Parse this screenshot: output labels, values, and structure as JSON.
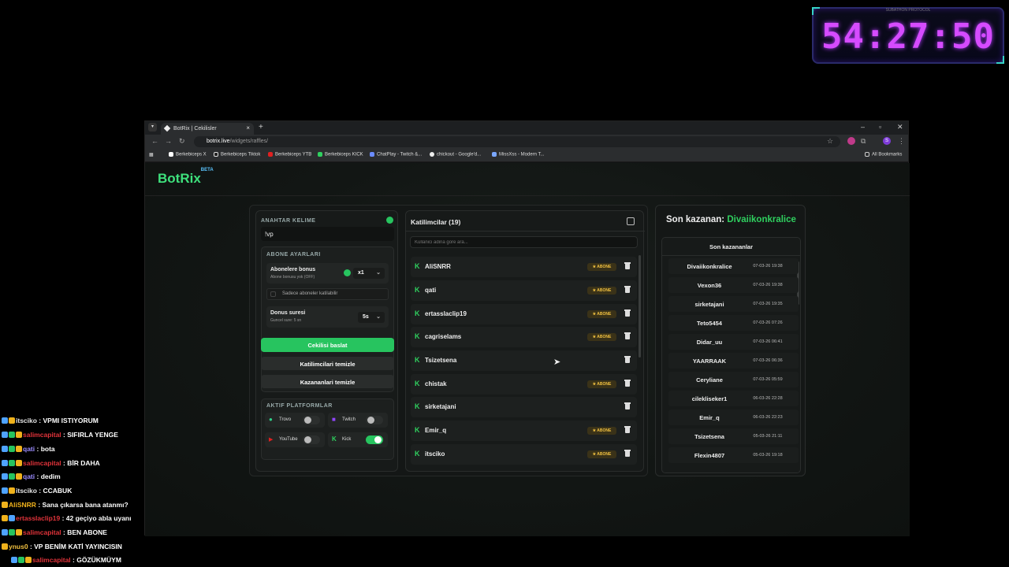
{
  "timer": {
    "caption": "SUBATHON PROTOCOL",
    "value": "54:27:50"
  },
  "browser": {
    "tab_title": "BotRix | Cekilisler",
    "url_host": "botrix.live",
    "url_path": "/widgets/raffles/",
    "bookmarks": [
      "Berkebiceps X",
      "Berkebiceps Tiktok",
      "Berkebiceps YTB",
      "Berkebiceps KICK",
      "ChatPlay - Twitch &...",
      "chickout - Google'd...",
      "MissXss - Modern T..."
    ],
    "all_bookmarks": "All Bookmarks",
    "profile_initial": "S"
  },
  "app": {
    "logo": "BotRix",
    "logo_badge": "BETA"
  },
  "settings": {
    "keyword_label": "ANAHTAR KELIME",
    "keyword_value": "!vp",
    "sub_settings_label": "ABONE AYARLARI",
    "sub_bonus_title": "Abonelere bonus",
    "sub_bonus_desc": "Abone bonusu yok (OFF)",
    "multiplier": "x1",
    "subs_only_label": "Sadece aboneler katilabilir",
    "duration_title": "Donus suresi",
    "duration_desc": "Guncel sure: 5 sn",
    "duration_value": "5s",
    "start_button": "Cekilisi baslat",
    "clear_participants_button": "Katilimcilari temizle",
    "clear_winners_button": "Kazananlari temizle",
    "platforms_label": "AKTIF PLATFORMLAR",
    "platforms": [
      {
        "name": "Trovo",
        "on": false
      },
      {
        "name": "Twitch",
        "on": false
      },
      {
        "name": "YouTube",
        "on": false
      },
      {
        "name": "Kick",
        "on": true
      }
    ]
  },
  "participants": {
    "title": "Katilimcilar (19)",
    "search_placeholder": "Kullanici adina gore ara...",
    "badge_label": "★ ABONE",
    "rows": [
      {
        "name": "AliSNRR",
        "sub": true
      },
      {
        "name": "qati",
        "sub": true
      },
      {
        "name": "ertasslaclip19",
        "sub": true
      },
      {
        "name": "cagriselams",
        "sub": true
      },
      {
        "name": "Tsizetsena",
        "sub": false
      },
      {
        "name": "chistak",
        "sub": true
      },
      {
        "name": "sirketajani",
        "sub": false
      },
      {
        "name": "Emir_q",
        "sub": true
      },
      {
        "name": "itsciko",
        "sub": true
      }
    ]
  },
  "winners": {
    "headline_prefix": "Son kazanan:",
    "headline_name": "Divaiikonkralice",
    "list_title": "Son kazananlar",
    "rows": [
      {
        "name": "Divaiikonkralice",
        "date": "07-03-26 19:38"
      },
      {
        "name": "Vexon36",
        "date": "07-03-26 19:38"
      },
      {
        "name": "sirketajani",
        "date": "07-03-26 19:35"
      },
      {
        "name": "Teto5454",
        "date": "07-03-26 07:26"
      },
      {
        "name": "Didar_uu",
        "date": "07-03-26 06:41"
      },
      {
        "name": "YAARRAAK",
        "date": "07-03-26 06:36"
      },
      {
        "name": "Ceryliane",
        "date": "07-03-26 05:59"
      },
      {
        "name": "cilekliseker1",
        "date": "06-03-26 22:28"
      },
      {
        "name": "Emir_q",
        "date": "06-03-26 22:23"
      },
      {
        "name": "Tsizetsena",
        "date": "05-03-26 21:11"
      },
      {
        "name": "Flexin4807",
        "date": "05-03-26 19:18"
      }
    ]
  },
  "chat": [
    {
      "user": "itsciko",
      "msg": "VPMI ISTIYORUM",
      "color": "#e6e6e6"
    },
    {
      "user": "salimcapital",
      "msg": "SIFIRLA YENGE",
      "color": "#e0333a"
    },
    {
      "user": "qati",
      "msg": "bota",
      "color": "#9b8cff"
    },
    {
      "user": "salimcapital",
      "msg": "BİR DAHA",
      "color": "#e0333a"
    },
    {
      "user": "qati",
      "msg": "dedim",
      "color": "#9b8cff"
    },
    {
      "user": "itsciko",
      "msg": "CCABUK",
      "color": "#e6e6e6"
    },
    {
      "user": "AliSNRR",
      "msg": "Sana çıkarsa bana atanmı?",
      "color": "#f0b21c"
    },
    {
      "user": "ertasslaclip19",
      "msg": "42 geçiyo abla uyanı",
      "color": "#e0333a"
    },
    {
      "user": "salimcapital",
      "msg": "BEN ABONE",
      "color": "#e0333a"
    },
    {
      "user": "ynus0",
      "msg": "VP BENİM KATİ YAYINCISIN",
      "color": "#f0c040"
    },
    {
      "user": "salimcapital",
      "msg": "GÖZÜKMÜYM",
      "color": "#e0333a"
    }
  ],
  "colors": {
    "accent": "#27c45f",
    "timer": "#d64bff",
    "badge": "#f0c040"
  }
}
